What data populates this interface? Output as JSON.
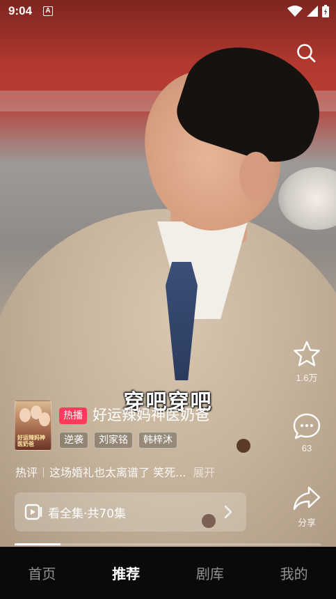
{
  "status_bar": {
    "time": "9:04",
    "notification_badge": "A"
  },
  "video": {
    "subtitle": "穿吧穿吧"
  },
  "actions": {
    "favorite_count": "1.6万",
    "comment_count": "63",
    "share_label": "分享"
  },
  "drama": {
    "badge": "热播",
    "title": "好运辣妈神医奶爸",
    "tags": [
      "逆袭",
      "刘家铭",
      "韩梓沐"
    ],
    "poster_text": "好运辣妈神医奶爸"
  },
  "hot_comment": {
    "label": "热评",
    "text": "这场婚礼也太离谱了 笑死...",
    "expand": "展开"
  },
  "watch_all": {
    "label": "看全集·共70集"
  },
  "playback_progress": 0.15,
  "bottom_nav": {
    "items": [
      "首页",
      "推荐",
      "剧库",
      "我的"
    ],
    "active": "推荐"
  },
  "colors": {
    "hot_badge": "#ff3b5c",
    "nav_bg": "#0a0a0a"
  }
}
